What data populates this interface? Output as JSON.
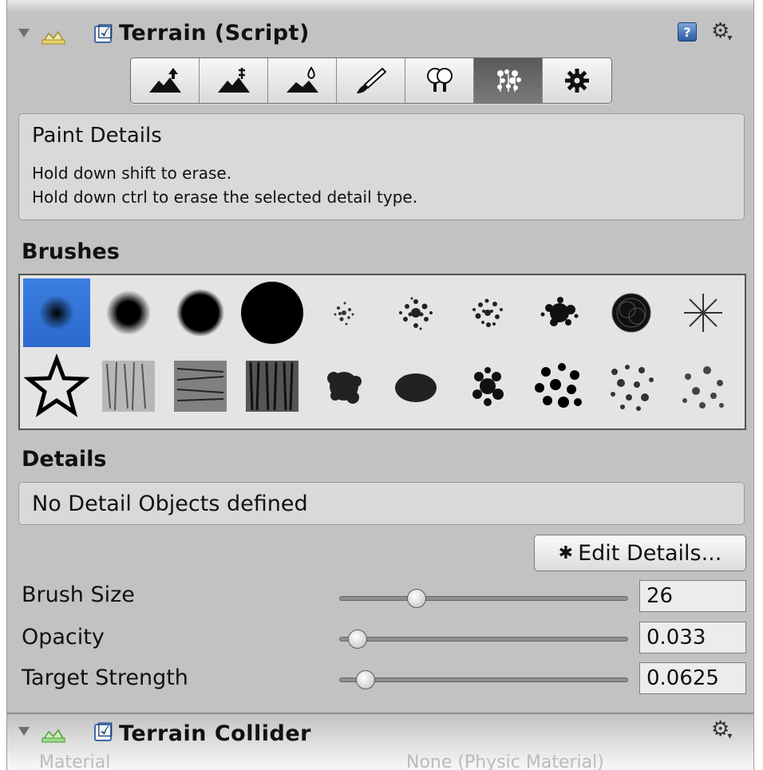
{
  "component": {
    "title": "Terrain (Script)",
    "enabled": true,
    "enabled_mark": "☑"
  },
  "toolbar": {
    "tools": [
      {
        "icon": "raise-lower-terrain-icon",
        "active": false
      },
      {
        "icon": "paint-height-icon",
        "active": false
      },
      {
        "icon": "smooth-height-icon",
        "active": false
      },
      {
        "icon": "paint-texture-icon",
        "active": false
      },
      {
        "icon": "place-trees-icon",
        "active": false
      },
      {
        "icon": "paint-details-icon",
        "active": true
      },
      {
        "icon": "terrain-settings-icon",
        "active": false
      }
    ]
  },
  "info": {
    "title": "Paint Details",
    "line1": "Hold down shift to erase.",
    "line2": "Hold down ctrl to erase the selected detail type."
  },
  "brushes": {
    "label": "Brushes",
    "selected_index": 0
  },
  "details": {
    "label": "Details",
    "empty_text": "No Detail Objects defined",
    "edit_button": "Edit Details..."
  },
  "settings": {
    "brush_size": {
      "label": "Brush Size",
      "value": "26",
      "fraction": 0.25
    },
    "opacity": {
      "label": "Opacity",
      "value": "0.033",
      "fraction": 0.033
    },
    "target_strength": {
      "label": "Target Strength",
      "value": "0.0625",
      "fraction": 0.0625
    }
  },
  "collider": {
    "title": "Terrain Collider",
    "material_label": "Material",
    "material_value": "None (Physic Material)"
  },
  "colors": {
    "panel": "#c2c2c2",
    "selected_brush": "#2b6acd",
    "active_tool": "#5a5a5a"
  }
}
